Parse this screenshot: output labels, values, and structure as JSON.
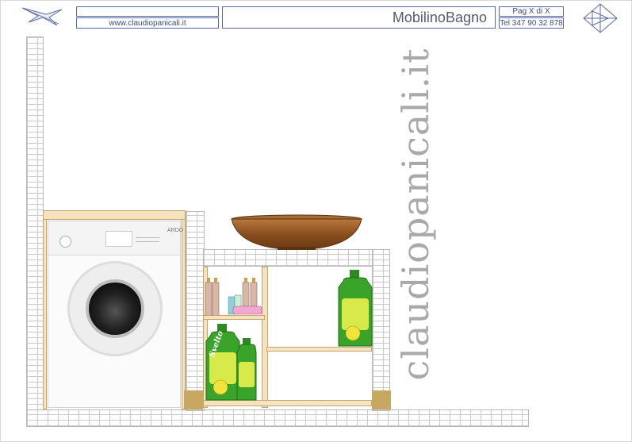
{
  "header": {
    "website": "www.claudiopanicali.it",
    "title": "MobilinoBagno",
    "page": "Pag X di X",
    "phone": "Tel 347 90 32 878"
  },
  "drawing": {
    "watermark": "claudiopanicali.it",
    "washing_machine_brand": "ARDO",
    "detergent_brand": "Svelto"
  },
  "colors": {
    "border": "#5a6aa8",
    "wood": "#f3e3bf",
    "brick_line": "#c9c9c9",
    "bottle_green": "#3aa32a",
    "basin": "#8a4e1e"
  }
}
